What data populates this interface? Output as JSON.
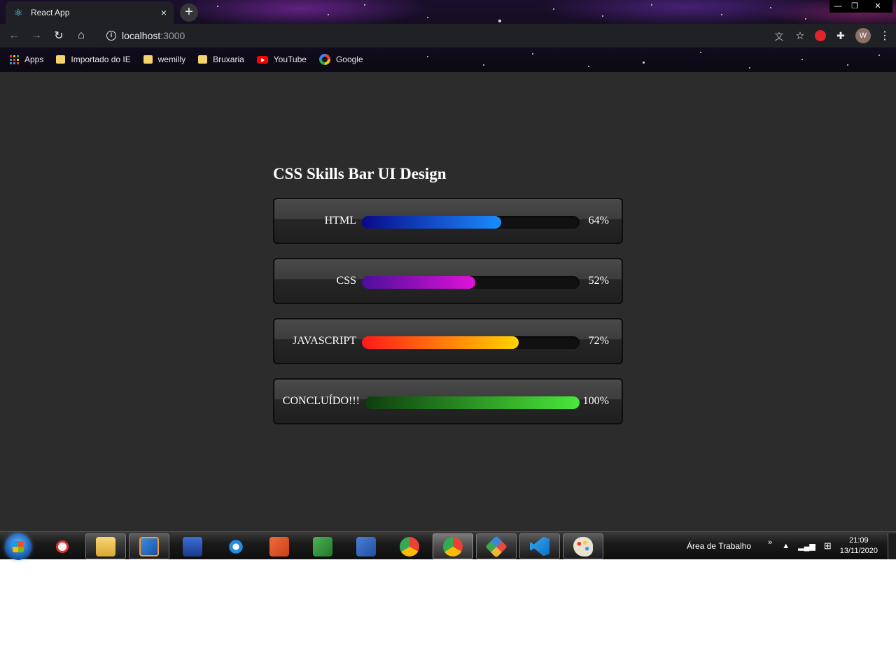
{
  "browser": {
    "tab_title": "React App",
    "tab_close": "×",
    "new_tab": "+",
    "url_host": "localhost",
    "url_port": ":3000",
    "bookmarks": [
      "Apps",
      "Importado do IE",
      "wemilly",
      "Bruxaria",
      "YouTube",
      "Google"
    ],
    "avatar_letter": "W",
    "icons": [
      "react-icon",
      "back-icon",
      "forward-icon",
      "reload-icon",
      "home-icon",
      "info-icon",
      "translate-icon",
      "star-icon",
      "extension-red-icon",
      "puzzle-icon",
      "menu-dots-icon"
    ]
  },
  "page": {
    "heading": "CSS Skills Bar UI Design",
    "skills": [
      {
        "label": "HTML",
        "percent_text": "64%",
        "level": 0.64,
        "color_start": "#0a0a8a",
        "color_end": "#1a8cff"
      },
      {
        "label": "CSS",
        "percent_text": "52%",
        "level": 0.52,
        "color_start": "#4b0f9a",
        "color_end": "#e012d8"
      },
      {
        "label": "JAVASCRIPT",
        "percent_text": "72%",
        "level": 0.72,
        "color_start": "#ff1a1a",
        "color_end": "#ffd400"
      },
      {
        "label": "CONCLUÍDO!!!",
        "percent_text": "100%",
        "level": 1.0,
        "color_start": "#0e3d0e",
        "color_end": "#4ae83a"
      }
    ],
    "background_color": "#2c2c2c"
  },
  "taskbar": {
    "desktop_label": "Área de Trabalho",
    "chevron": "»",
    "time": "21:09",
    "date": "13/11/2020",
    "apps": [
      "start-orb",
      "snipping-tool",
      "file-explorer",
      "media-player",
      "scanner",
      "internet-explorer",
      "powerpoint",
      "excel",
      "word",
      "chrome",
      "chrome-profile-w",
      "git-kraken",
      "vscode",
      "paint"
    ]
  }
}
